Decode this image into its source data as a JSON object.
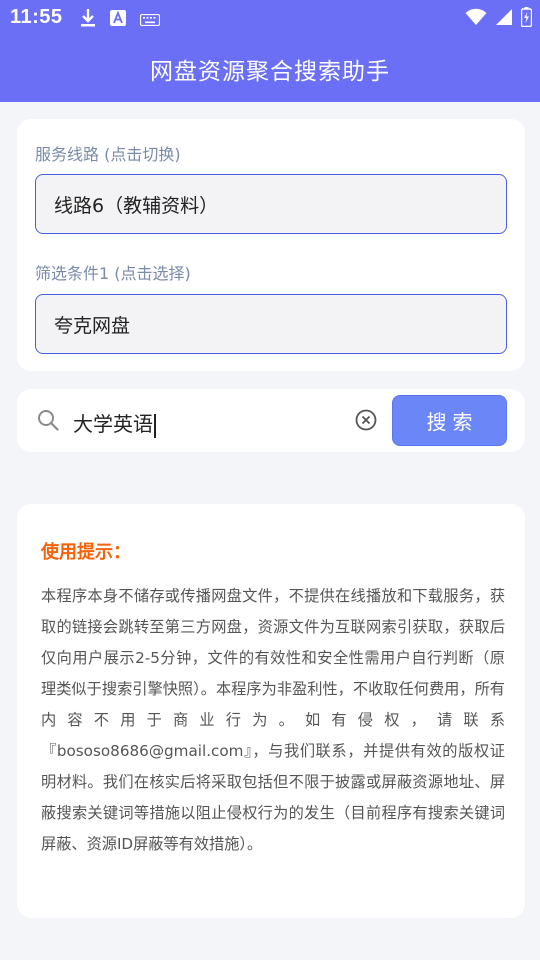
{
  "status_bar": {
    "time": "11:55",
    "left_icons": [
      "download-icon",
      "font-a-icon",
      "keyboard-icon"
    ],
    "right_icons": [
      "wifi-icon",
      "signal-icon",
      "battery-icon"
    ]
  },
  "header": {
    "title": "网盘资源聚合搜索助手"
  },
  "route": {
    "label": "服务线路 (点击切换)",
    "value": "线路6（教辅资料）"
  },
  "filter": {
    "label": "筛选条件1 (点击选择)",
    "value": "夸克网盘"
  },
  "search": {
    "query": "大学英语",
    "button_label": "搜索"
  },
  "notice": {
    "title": "使用提示：",
    "body": "本程序本身不储存或传播网盘文件，不提供在线播放和下载服务，获取的链接会跳转至第三方网盘，资源文件为互联网索引获取，获取后仅向用户展示2-5分钟，文件的有效性和安全性需用户自行判断（原理类似于搜索引擎快照）。本程序为非盈利性，不收取任何费用，所有内容不用于商业行为。如有侵权，请联系『bososo8686@gmail.com』，与我们联系，并提供有效的版权证明材料。我们在核实后将采取包括但不限于披露或屏蔽资源地址、屏蔽搜索关键词等措施以阻止侵权行为的发生（目前程序有搜索关键词屏蔽、资源ID屏蔽等有效措施）。"
  },
  "colors": {
    "header": "#6b6ff5",
    "field_border": "#4a5ee0",
    "search_button": "#6a86f7",
    "notice_title": "#f5620a"
  }
}
